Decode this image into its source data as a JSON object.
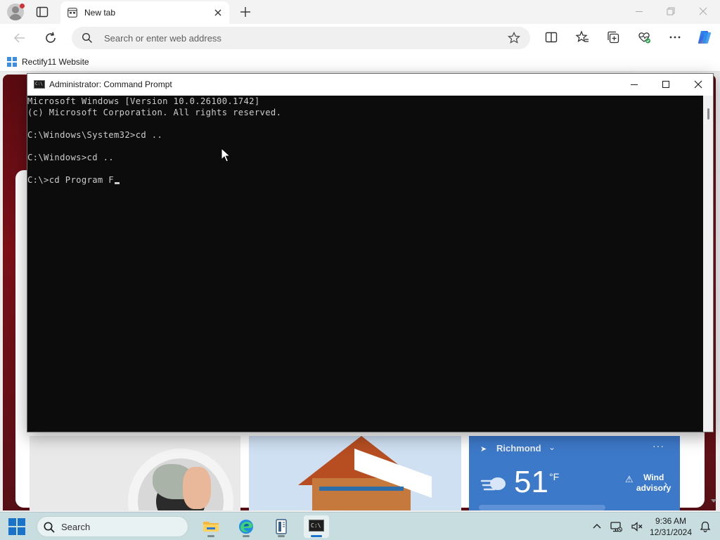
{
  "browser": {
    "tab": {
      "title": "New tab"
    },
    "search": {
      "placeholder": "Search or enter web address"
    },
    "favorites": [
      {
        "label": "Rectify11 Website"
      }
    ]
  },
  "cmd": {
    "title": "Administrator: Command Prompt",
    "lines": [
      "Microsoft Windows [Version 10.0.26100.1742]",
      "(c) Microsoft Corporation. All rights reserved.",
      "",
      "C:\\Windows\\System32>cd ..",
      "",
      "C:\\Windows>cd ..",
      "",
      "C:\\>cd Program F"
    ]
  },
  "weather": {
    "location": "Richmond",
    "temperature": "51",
    "unit": "°F",
    "alert_line1": "Wind",
    "alert_line2": "advisory"
  },
  "taskbar": {
    "search_label": "Search",
    "cmd_icon_text": "C:\\",
    "time": "9:36 AM",
    "date": "12/31/2024"
  },
  "colors": {
    "taskbar": "#c7dde0",
    "console_bg": "#0c0c0c",
    "console_text": "#cccccc",
    "weather_card": "#3d79c9",
    "accent": "#1a73c9"
  }
}
